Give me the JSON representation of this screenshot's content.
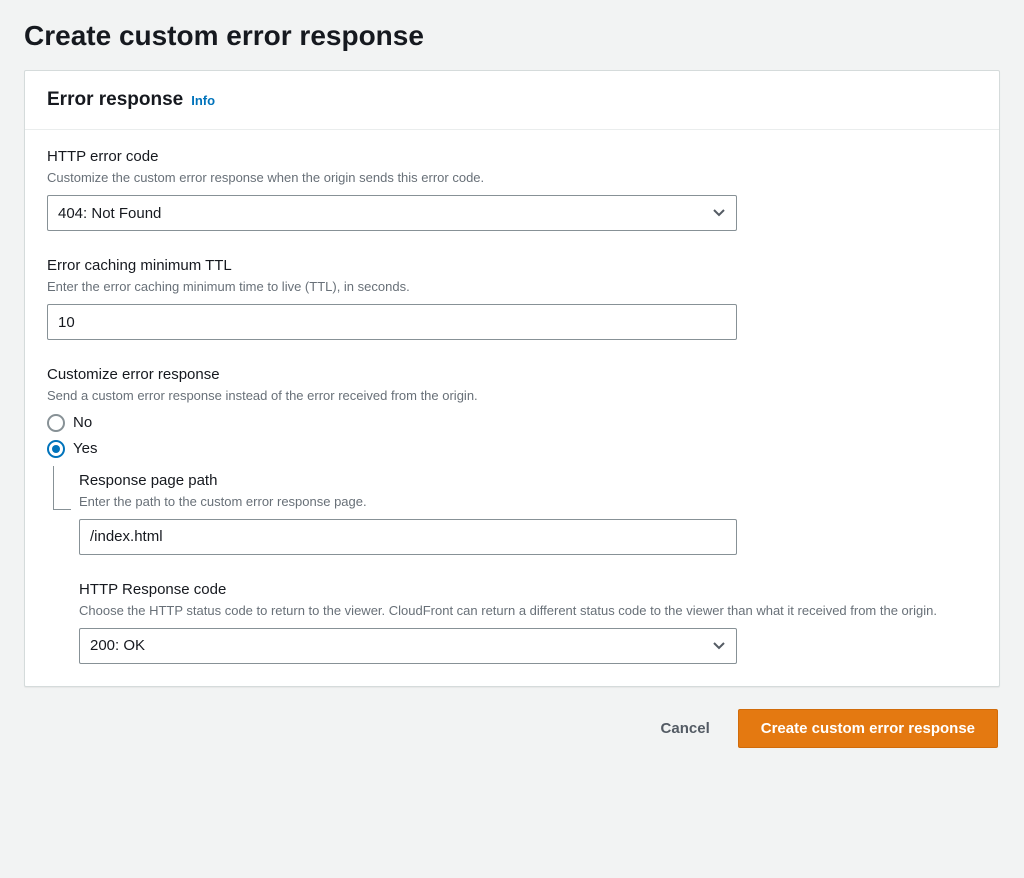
{
  "page": {
    "title": "Create custom error response"
  },
  "panel": {
    "title": "Error response",
    "info_link": "Info"
  },
  "fields": {
    "http_error_code": {
      "label": "HTTP error code",
      "desc": "Customize the custom error response when the origin sends this error code.",
      "value": "404: Not Found"
    },
    "ttl": {
      "label": "Error caching minimum TTL",
      "desc": "Enter the error caching minimum time to live (TTL), in seconds.",
      "value": "10"
    },
    "customize": {
      "label": "Customize error response",
      "desc": "Send a custom error response instead of the error received from the origin.",
      "options": {
        "no": "No",
        "yes": "Yes"
      },
      "selected": "yes"
    },
    "response_path": {
      "label": "Response page path",
      "desc": "Enter the path to the custom error response page.",
      "value": "/index.html"
    },
    "http_response_code": {
      "label": "HTTP Response code",
      "desc": "Choose the HTTP status code to return to the viewer. CloudFront can return a different status code to the viewer than what it received from the origin.",
      "value": "200: OK"
    }
  },
  "footer": {
    "cancel": "Cancel",
    "primary": "Create custom error response"
  }
}
